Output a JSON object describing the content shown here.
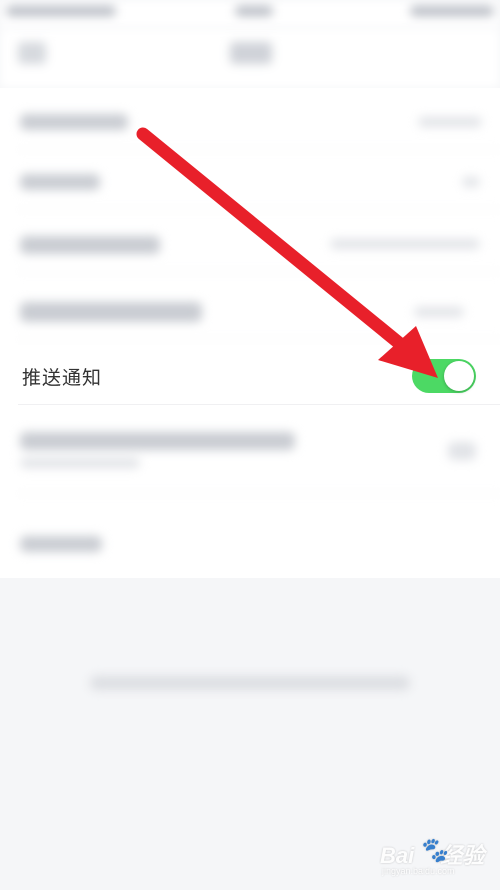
{
  "push_notification": {
    "label": "推送通知",
    "enabled": true,
    "toggle_color": "#4cd964"
  },
  "annotation": {
    "arrow_color": "#e8202a"
  },
  "watermark": {
    "brand_prefix": "Bai",
    "paw_glyph": "🐾",
    "brand_suffix": "经验",
    "url": "jingyan.baidu.com"
  }
}
